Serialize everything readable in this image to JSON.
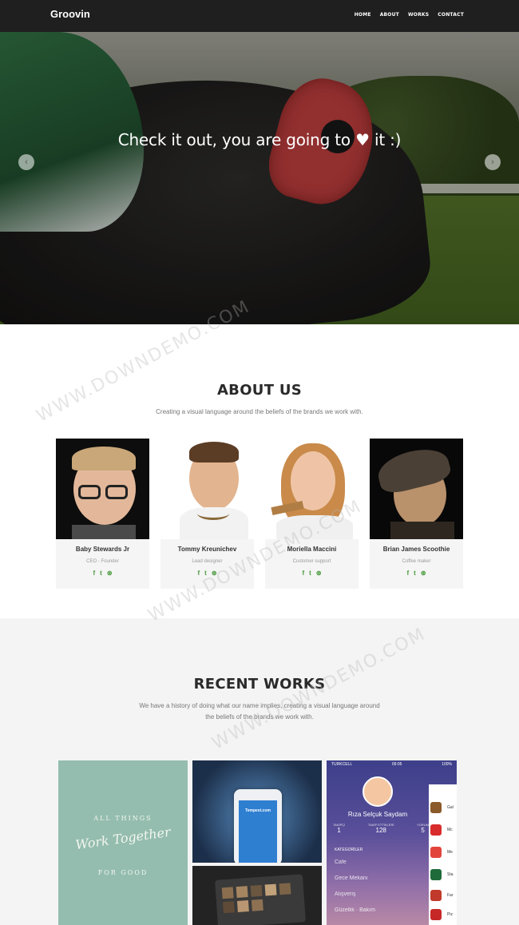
{
  "nav": {
    "brand": "Groovin",
    "items": [
      "HOME",
      "ABOUT",
      "WORKS",
      "CONTACT"
    ]
  },
  "hero": {
    "title_before": "Check it out, you are going to",
    "heart": "♥",
    "title_after": "it :)",
    "prev_icon": "‹",
    "next_icon": "›"
  },
  "about": {
    "title": "ABOUT US",
    "subtitle": "Creating a visual language around the beliefs of the brands we work with.",
    "team": [
      {
        "name": "Baby Stewards Jr",
        "role": "CEO - Founder"
      },
      {
        "name": "Tommy Kreunichev",
        "role": "Lead designer"
      },
      {
        "name": "Moriella Maccini",
        "role": "Customer support"
      },
      {
        "name": "Brian James Scoothie",
        "role": "Coffee maker"
      }
    ],
    "social": {
      "facebook": "f",
      "twitter": "t",
      "dribbble": "⊛"
    }
  },
  "works": {
    "title": "RECENT WORKS",
    "subtitle_line1": "We have a history of doing what our name implies, creating a visual language around",
    "subtitle_line2": "the beliefs of the brands we work with.",
    "tile1": {
      "line1": "ALL THINGS",
      "line2": "Work Together",
      "line3": "FOR GOOD"
    },
    "tile2": {
      "app": "Tempest.com"
    },
    "tile4": {
      "carrier": "TURKCELL",
      "time": "09:05",
      "battery": "100%",
      "user": "Rıza Selçuk Saydam",
      "stats": [
        {
          "label": "TAKİPÇİ",
          "value": "1"
        },
        {
          "label": "TAKİP ETTİKLERİ",
          "value": "128"
        },
        {
          "label": "YORUM",
          "value": "5"
        }
      ],
      "category": "KATEGORİLER",
      "menu": [
        "Cafe",
        "Gece Mekanı",
        "Alışveriş",
        "Güzellik · Bakım"
      ],
      "apps": [
        "Gal",
        "Mc",
        "Me",
        "Sta",
        "Far",
        "Piz"
      ]
    }
  },
  "watermark": "WWW.DOWNDEMO.COM"
}
